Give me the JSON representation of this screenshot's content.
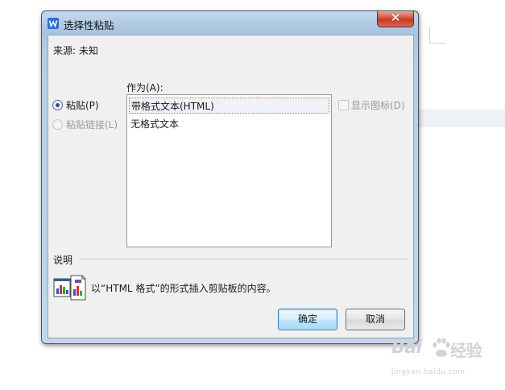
{
  "window": {
    "title": "选择性粘贴",
    "close_label": "✕"
  },
  "source": {
    "text": "来源: 未知"
  },
  "paste_as": {
    "label": "作为(A):",
    "options": [
      {
        "label": "带格式文本(HTML)",
        "selected": true
      },
      {
        "label": "无格式文本",
        "selected": false
      }
    ]
  },
  "paste_mode": {
    "paste_label": "粘贴(P)",
    "paste_checked": true,
    "paste_link_label": "粘贴链接(L)",
    "paste_link_enabled": false
  },
  "display_as_icon": {
    "label": "显示图标(D)",
    "checked": false,
    "enabled": false
  },
  "description": {
    "title": "说明",
    "text": "以“HTML 格式”的形式插入剪贴板的内容。",
    "icon": "paste-result-icon"
  },
  "buttons": {
    "ok": "确定",
    "cancel": "取消"
  },
  "watermark": {
    "brand": "Bai",
    "brand_suffix": "经验",
    "url": "jingyan.baidu.com"
  },
  "colors": {
    "titlebar": "#b3cce6",
    "close_button": "#c33a25",
    "default_button_border": "#3c7fb1",
    "selection_highlight": "#eef1f7"
  }
}
